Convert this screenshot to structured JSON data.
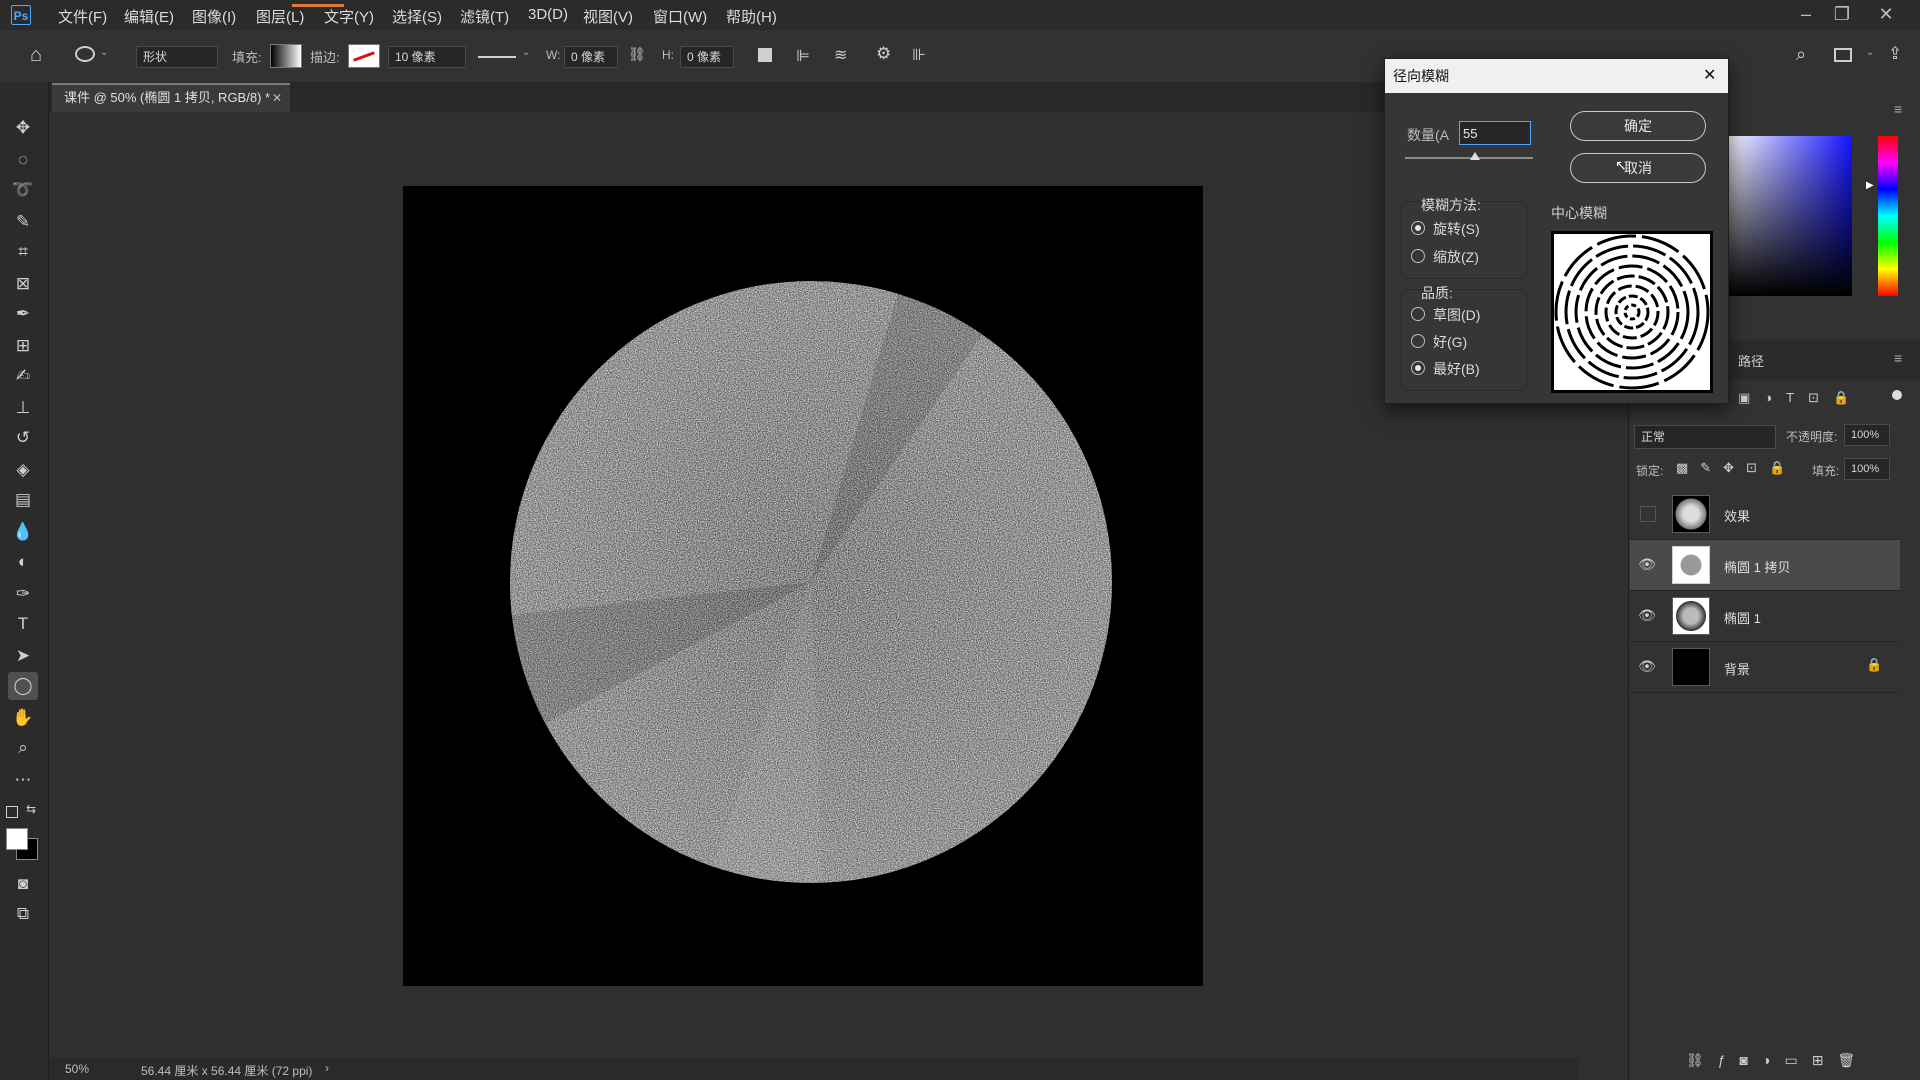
{
  "app": {
    "logo": "Ps"
  },
  "menu": [
    "文件(F)",
    "编辑(E)",
    "图像(I)",
    "图层(L)",
    "文字(Y)",
    "选择(S)",
    "滤镜(T)",
    "3D(D)",
    "视图(V)",
    "窗口(W)",
    "帮助(H)"
  ],
  "options": {
    "shape_mode": "形状",
    "fill_label": "填充:",
    "stroke_label": "描边:",
    "stroke_size": "10 像素",
    "w_label": "W:",
    "w_value": "0 像素",
    "h_label": "H:",
    "h_value": "0 像素"
  },
  "document": {
    "tab_title": "课件 @ 50% (椭圆 1 拷贝, RGB/8) *",
    "zoom": "50%",
    "doc_size": "56.44 厘米 x 56.44 厘米 (72 ppi)"
  },
  "dialog": {
    "title": "径向模糊",
    "amount_label": "数量(A",
    "amount_value": "55",
    "amount_fraction": 0.55,
    "ok": "确定",
    "cancel": "取消",
    "method_label": "模糊方法:",
    "method_spin": "旋转(S)",
    "method_zoom": "缩放(Z)",
    "quality_label": "品质:",
    "quality_draft": "草图(D)",
    "quality_good": "好(G)",
    "quality_best": "最好(B)",
    "center_label": "中心模糊"
  },
  "panels": {
    "paths_tab": "路径",
    "blend_mode": "正常",
    "opacity_label": "不透明度:",
    "opacity_value": "100%",
    "lock_label": "锁定:",
    "fill_label": "填充:",
    "fill_value": "100%"
  },
  "layers": [
    {
      "name": "效果",
      "visible": false
    },
    {
      "name": "椭圆 1 拷贝",
      "visible": true,
      "selected": true
    },
    {
      "name": "椭圆 1",
      "visible": true
    },
    {
      "name": "背景",
      "visible": true,
      "locked": true
    }
  ],
  "colors": {
    "accent": "#4ea8ff",
    "selected_row": "#4a4a4a"
  }
}
